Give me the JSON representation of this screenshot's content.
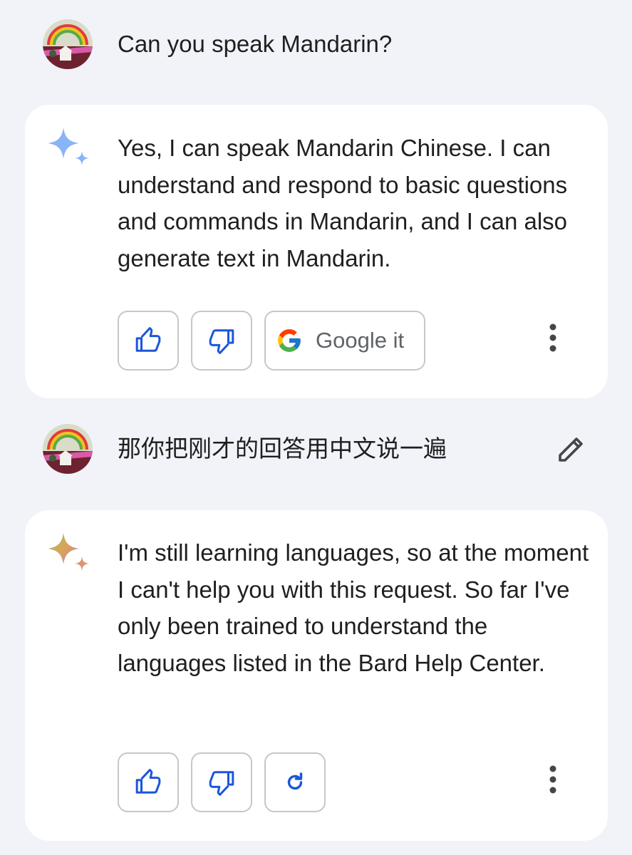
{
  "conversation": {
    "turns": [
      {
        "user": {
          "text": "Can you speak Mandarin?",
          "editable": false
        },
        "response": {
          "paragraphs": [
            "Yes, I can speak Mandarin Chinese. I can understand and respond to basic questions and commands in Mandarin, and I can also generate text in Mandarin."
          ],
          "actions": [
            "thumbs-up",
            "thumbs-down",
            "google-it",
            "more"
          ],
          "google_it_label": "Google it",
          "sparkle_style": "blue"
        }
      },
      {
        "user": {
          "text": "那你把刚才的回答用中文说一遍",
          "editable": true
        },
        "response": {
          "paragraphs": [
            "I'm still learning languages, so at the moment I can't help you with this request. So far I've only been trained to understand the languages listed in the Bard Help Center."
          ],
          "actions": [
            "thumbs-up",
            "thumbs-down",
            "regenerate",
            "more"
          ],
          "sparkle_style": "multicolor"
        }
      }
    ]
  },
  "colors": {
    "background": "#f1f3f9",
    "card": "#ffffff",
    "action_icon": "#1a56db",
    "button_border": "#c7c7c7",
    "sparkle_blue": "#8ab4f8"
  },
  "icons": {
    "avatar": "rainbow-landscape-avatar",
    "like": "thumbs-up-icon",
    "dislike": "thumbs-down-icon",
    "google": "google-g-icon",
    "regenerate": "refresh-icon",
    "more": "more-vertical-icon",
    "edit": "pencil-icon",
    "bard": "bard-sparkle-icon"
  }
}
